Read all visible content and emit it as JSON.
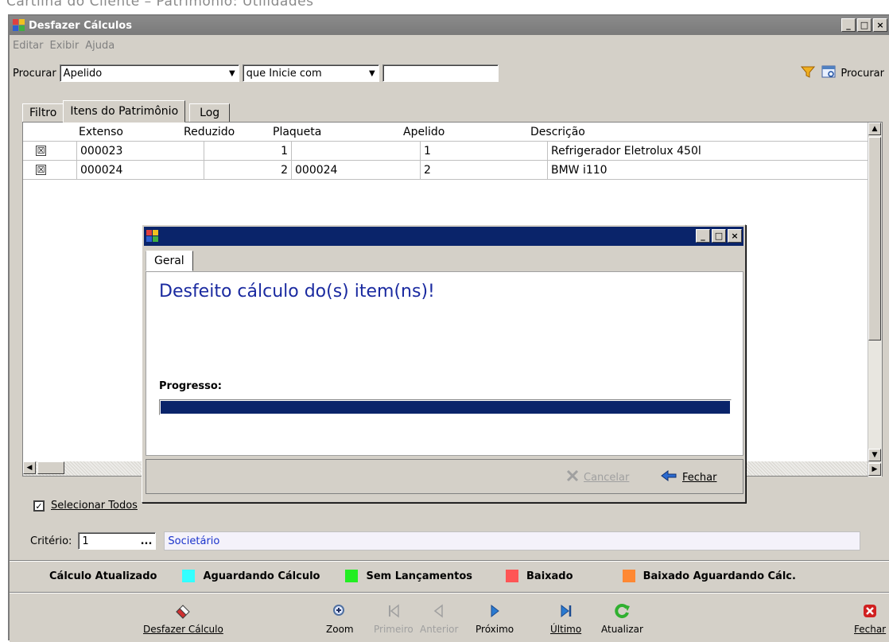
{
  "doc_caption": "Cartilha do Cliente – Patrimônio: Utilidades",
  "window": {
    "title": "Desfazer Cálculos"
  },
  "titlebar_buttons": [
    "_",
    "□",
    "×"
  ],
  "menu": [
    "Editar",
    "Exibir",
    "Ajuda"
  ],
  "search": {
    "label": "Procurar",
    "field": "Apelido",
    "operator": "que Inicie com",
    "value": "",
    "button_label": "Procurar"
  },
  "tabs": [
    "Filtro",
    "Itens do Patrimônio",
    "Log"
  ],
  "grid": {
    "columns": [
      "Extenso",
      "Reduzido",
      "Plaqueta",
      "Apelido",
      "Descrição"
    ],
    "rows": [
      {
        "checked": "☒",
        "extenso": "000023",
        "reduzido": "1",
        "plaqueta": "",
        "apelido": "1",
        "descricao": "Refrigerador Eletrolux 450l"
      },
      {
        "checked": "☒",
        "extenso": "000024",
        "reduzido": "2",
        "plaqueta": "000024",
        "apelido": "2",
        "descricao": "BMW i110"
      }
    ]
  },
  "select_all_label": "Selecionar Todos",
  "criterio": {
    "label": "Critério:",
    "value": "1",
    "ellipsis": "...",
    "description": "Societário"
  },
  "legend": [
    {
      "label": "Cálculo Atualizado",
      "color": ""
    },
    {
      "label": "Aguardando Cálculo",
      "color": "#33ffff"
    },
    {
      "label": "Sem Lançamentos",
      "color": "#22ee22"
    },
    {
      "label": "Baixado",
      "color": "#ff5555"
    },
    {
      "label": "Baixado Aguardando Cálc.",
      "color": "#ff8833"
    }
  ],
  "toolbar": {
    "desfazer": "Desfazer Cálculo",
    "zoom": "Zoom",
    "primeiro": "Primeiro",
    "anterior": "Anterior",
    "proximo": "Próximo",
    "ultimo": "Último",
    "atualizar": "Atualizar",
    "fechar": "Fechar"
  },
  "dialog": {
    "tab": "Geral",
    "message": "Desfeito cálculo do(s) item(ns)!",
    "progress_label": "Progresso:",
    "progress": 1.0,
    "cancel_label": "Cancelar",
    "close_label": "Fechar"
  },
  "icons": {
    "filter": "filter-icon",
    "search": "search-icon",
    "undo": "eraser-icon",
    "zoom": "zoom-icon",
    "first": "first-icon",
    "prev": "prev-icon",
    "next": "next-icon",
    "last": "last-icon",
    "refresh": "refresh-icon",
    "close": "close-icon"
  },
  "colors": {
    "dialog_title": "#0a246a",
    "progress": "#0a246a",
    "message": "#1a2aa0",
    "criterio_desc": "#1a33cc"
  }
}
